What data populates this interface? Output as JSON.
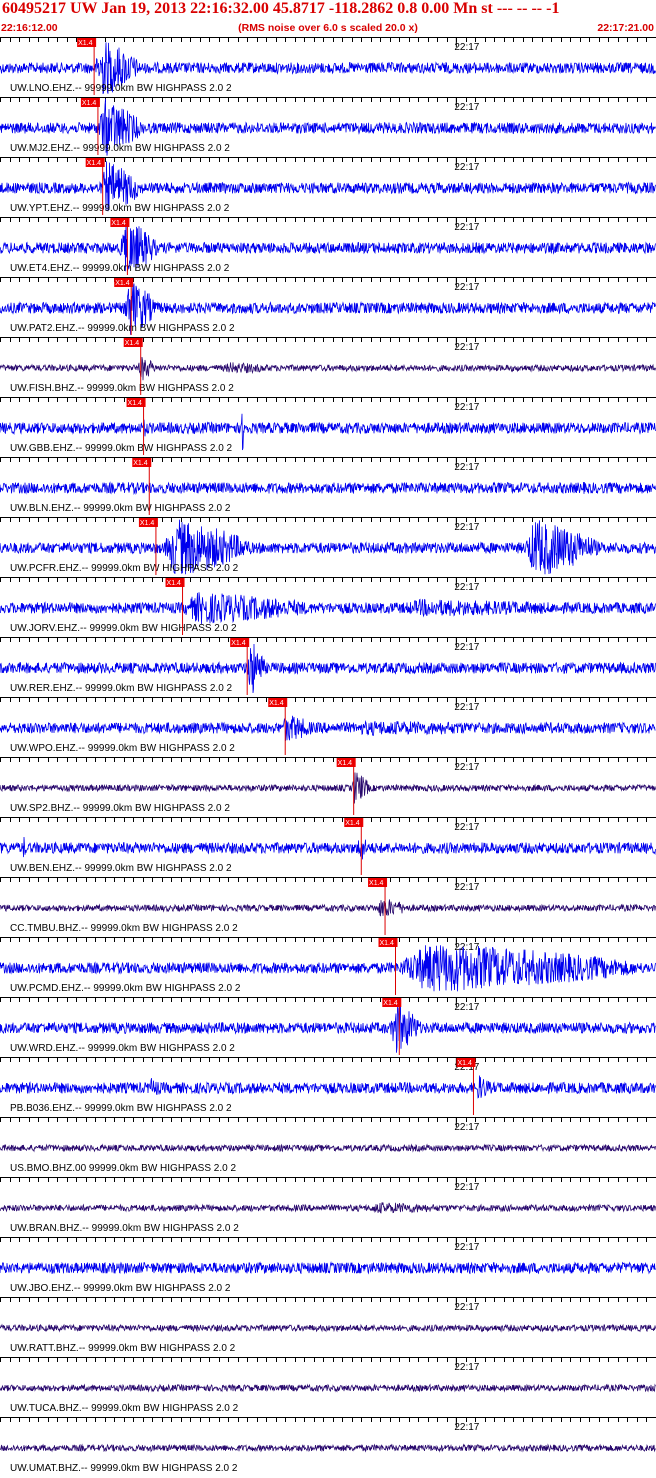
{
  "header": {
    "title": "60495217 UW Jan 19, 2013 22:16:32.00   45.8717 -118.2862  0.8 0.00 Mn st --- -- --   -1",
    "start_time": "22:16:12.00",
    "noise_note": "(RMS noise over 6.0 s scaled 20.0 x)",
    "end_time": "22:17:21.00"
  },
  "colors": {
    "header_text": "#d80000",
    "trace_blue": "#0000ee",
    "trace_dark": "#2a0a6e",
    "pick_box": "#ee0000",
    "pick_line": "#dd0000",
    "tick": "#000000"
  },
  "chart_data": {
    "type": "line",
    "x_unit": "seconds since 22:16:12.00",
    "xlim": [
      0,
      69
    ],
    "minute_marker": {
      "label": "22:17",
      "x": 48
    },
    "pick_label": "X1.4",
    "traces": [
      {
        "label": "UW.LNO.EHZ.-- 99999.0km BW  HIGHPASS  2.0  2",
        "pick": 9.9,
        "color": "blue",
        "events": [
          {
            "start": 9.9,
            "end": 15.0,
            "amp": 1.0
          }
        ]
      },
      {
        "label": "UW.MJ2.EHZ.-- 99999.0km BW  HIGHPASS  2.0  2",
        "pick": 10.3,
        "color": "blue",
        "events": [
          {
            "start": 10.2,
            "end": 15.2,
            "amp": 1.0
          }
        ]
      },
      {
        "label": "UW.YPT.EHZ.-- 99999.0km BW  HIGHPASS  2.0  2",
        "pick": 10.8,
        "color": "blue",
        "events": [
          {
            "start": 10.5,
            "end": 15.2,
            "amp": 0.9
          }
        ]
      },
      {
        "label": "UW.ET4.EHZ.-- 99999.0km BW  HIGHPASS  2.0  2",
        "pick": 13.4,
        "color": "blue",
        "events": [
          {
            "start": 12.5,
            "end": 16.8,
            "amp": 1.0
          }
        ]
      },
      {
        "label": "UW.PAT2.EHZ.-- 99999.0km BW  HIGHPASS  2.0  2",
        "pick": 13.8,
        "color": "blue",
        "events": [
          {
            "start": 13.0,
            "end": 16.6,
            "amp": 1.0
          }
        ]
      },
      {
        "label": "UW.FISH.BHZ.-- 99999.0km BW  HIGHPASS  2.0  2",
        "pick": 14.8,
        "color": "dark",
        "events": [
          {
            "start": 14.5,
            "end": 16.5,
            "amp": 0.45
          },
          {
            "start": 23,
            "end": 31,
            "amp": 0.2
          }
        ]
      },
      {
        "label": "UW.GBB.EHZ.-- 99999.0km BW  HIGHPASS  2.0  2",
        "pick": 15.1,
        "color": "blue",
        "events": [
          {
            "start": 14.9,
            "end": 15.8,
            "amp": 0.35
          },
          {
            "start": 25.4,
            "end": 25.9,
            "amp": 0.9
          }
        ]
      },
      {
        "label": "UW.BLN.EHZ.-- 99999.0km BW  HIGHPASS  2.0  2",
        "pick": 15.7,
        "color": "blue",
        "events": [
          {
            "start": 10,
            "end": 30,
            "amp": 0.2
          },
          {
            "start": 35,
            "end": 50,
            "amp": 0.2
          },
          {
            "start": 60,
            "end": 69,
            "amp": 0.2
          }
        ]
      },
      {
        "label": "UW.PCFR.EHZ.-- 99999.0km BW  HIGHPASS  2.0  2",
        "pick": 16.4,
        "color": "blue",
        "events": [
          {
            "start": 17.0,
            "end": 27.0,
            "amp": 1.0
          },
          {
            "start": 55.0,
            "end": 63.5,
            "amp": 1.0
          }
        ]
      },
      {
        "label": "UW.JORV.EHZ.-- 99999.0km BW  HIGHPASS  2.0  2",
        "pick": 19.2,
        "color": "blue",
        "events": [
          {
            "start": 18.5,
            "end": 35.0,
            "amp": 0.55
          },
          {
            "start": 40,
            "end": 69,
            "amp": 0.3
          }
        ]
      },
      {
        "label": "UW.RER.EHZ.-- 99999.0km BW  HIGHPASS  2.0  2",
        "pick": 26.0,
        "color": "blue",
        "events": [
          {
            "start": 26.0,
            "end": 28.0,
            "amp": 1.0
          }
        ]
      },
      {
        "label": "UW.WPO.EHZ.-- 99999.0km BW  HIGHPASS  2.0  2",
        "pick": 30.0,
        "color": "blue",
        "events": [
          {
            "start": 29.5,
            "end": 33.5,
            "amp": 0.5
          },
          {
            "start": 33.5,
            "end": 69,
            "amp": 0.25
          }
        ]
      },
      {
        "label": "UW.SP2.BHZ.-- 99999.0km BW  HIGHPASS  2.0  2",
        "pick": 37.2,
        "color": "dark",
        "events": [
          {
            "start": 37.0,
            "end": 39.0,
            "amp": 0.6
          }
        ]
      },
      {
        "label": "UW.BEN.EHZ.-- 99999.0km BW  HIGHPASS  2.0  2",
        "pick": 38.0,
        "color": "blue",
        "events": [
          {
            "start": 2.4,
            "end": 2.8,
            "amp": 0.45
          },
          {
            "start": 37.6,
            "end": 38.8,
            "amp": 0.55
          },
          {
            "start": 47.0,
            "end": 47.3,
            "amp": 0.25
          }
        ]
      },
      {
        "label": "CC.TMBU.BHZ.-- 99999.0km BW  HIGHPASS  2.0  2",
        "pick": 40.5,
        "color": "dark",
        "events": [
          {
            "start": 39.5,
            "end": 43.5,
            "amp": 0.35
          }
        ]
      },
      {
        "label": "UW.PCMD.EHZ.-- 99999.0km BW  HIGHPASS  2.0  2",
        "pick": 41.6,
        "color": "blue",
        "events": [
          {
            "start": 41.0,
            "end": 69.0,
            "amp": 0.85
          }
        ]
      },
      {
        "label": "UW.WRD.EHZ.-- 99999.0km BW  HIGHPASS  2.0  2",
        "pick": 42.0,
        "color": "blue",
        "events": [
          {
            "start": 41.0,
            "end": 44.5,
            "amp": 0.9
          }
        ]
      },
      {
        "label": "PB.B036.EHZ.-- 99999.0km BW  HIGHPASS  2.0  2",
        "pick": 49.8,
        "color": "blue",
        "events": [
          {
            "start": 15.5,
            "end": 17.5,
            "amp": 0.35
          },
          {
            "start": 50.0,
            "end": 52.0,
            "amp": 0.45
          }
        ]
      },
      {
        "label": "US.BMO.BHZ.00 99999.0km BW  HIGHPASS  2.0  2",
        "color": "dark",
        "events": []
      },
      {
        "label": "UW.BRAN.BHZ.-- 99999.0km BW  HIGHPASS  2.0  2",
        "color": "dark",
        "events": [
          {
            "start": 38,
            "end": 50,
            "amp": 0.2
          }
        ]
      },
      {
        "label": "UW.JBO.EHZ.-- 99999.0km BW  HIGHPASS  2.0  2",
        "color": "blue",
        "events": []
      },
      {
        "label": "UW.RATT.BHZ.-- 99999.0km BW  HIGHPASS  2.0  2",
        "color": "dark",
        "events": []
      },
      {
        "label": "UW.TUCA.BHZ.-- 99999.0km BW  HIGHPASS  2.0  2",
        "color": "dark",
        "events": []
      },
      {
        "label": "UW.UMAT.BHZ.-- 99999.0km BW  HIGHPASS  2.0  2",
        "color": "dark",
        "events": []
      }
    ]
  }
}
